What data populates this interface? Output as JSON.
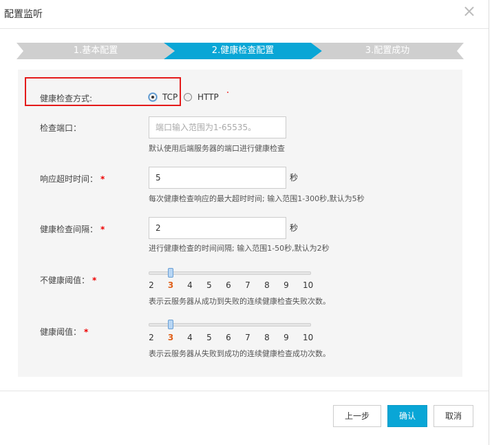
{
  "dialog": {
    "title": "配置监听",
    "close_glyph": "×"
  },
  "steps": [
    {
      "label": "1.基本配置",
      "state": "done"
    },
    {
      "label": "2.健康检查配置",
      "state": "active"
    },
    {
      "label": "3.配置成功",
      "state": "pending"
    }
  ],
  "form": {
    "method": {
      "label": "健康检查方式:",
      "options": [
        "TCP",
        "HTTP"
      ],
      "selected": "TCP"
    },
    "port": {
      "label": "检查端口：",
      "value": "",
      "placeholder": "端口输入范围为1-65535。",
      "help": "默认使用后端服务器的端口进行健康检查"
    },
    "timeout": {
      "label": "响应超时时间：",
      "required_mark": "*",
      "value": "5",
      "unit": "秒",
      "help": "每次健康检查响应的最大超时时间; 输入范围1-300秒,默认为5秒"
    },
    "interval": {
      "label": "健康检查间隔：",
      "required_mark": "*",
      "value": "2",
      "unit": "秒",
      "help": "进行健康检查的时间间隔; 输入范围1-50秒,默认为2秒"
    },
    "unhealthy_threshold": {
      "label": "不健康阈值：",
      "required_mark": "*",
      "ticks": [
        "2",
        "3",
        "4",
        "5",
        "6",
        "7",
        "8",
        "9",
        "10"
      ],
      "value": "3",
      "help": "表示云服务器从成功到失败的连续健康检查失败次数。"
    },
    "healthy_threshold": {
      "label": "健康阈值：",
      "required_mark": "*",
      "ticks": [
        "2",
        "3",
        "4",
        "5",
        "6",
        "7",
        "8",
        "9",
        "10"
      ],
      "value": "3",
      "help": "表示云服务器从失败到成功的连续健康检查成功次数。"
    }
  },
  "footer": {
    "prev_label": "上一步",
    "confirm_label": "确认",
    "cancel_label": "取消"
  },
  "colors": {
    "accent": "#09a6d6",
    "highlight_box": "#e41a1a",
    "required": "#e00000",
    "selected_tick": "#e0601a"
  }
}
